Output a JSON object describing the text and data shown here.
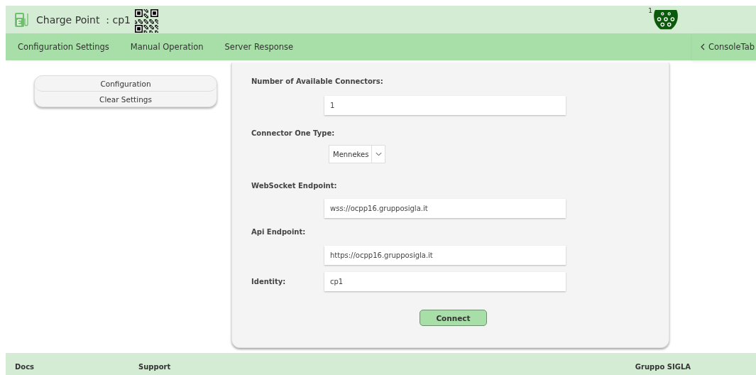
{
  "header": {
    "title": "Charge Point  : cp1",
    "connector_badge": "1"
  },
  "nav": {
    "tabs": [
      {
        "label": "Configuration Settings"
      },
      {
        "label": "Manual Operation"
      },
      {
        "label": "Server Response"
      }
    ],
    "console_tab": "ConsoleTab"
  },
  "sidebar": {
    "items": [
      {
        "label": "Configuration"
      },
      {
        "label": "Clear Settings"
      }
    ]
  },
  "form": {
    "fields": [
      {
        "kind": "input",
        "label": "Number of Available Connectors:",
        "value": "1"
      },
      {
        "kind": "select",
        "label": "Connector One Type:",
        "value": "Mennekes"
      },
      {
        "kind": "input",
        "label": "WebSocket Endpoint:",
        "value": "wss://ocpp16.grupposigla.it"
      },
      {
        "kind": "input",
        "label": "Api Endpoint:",
        "value": "https://ocpp16.grupposigla.it"
      },
      {
        "kind": "inline",
        "label": "Identity:",
        "value": "cp1"
      }
    ],
    "submit": "Connect"
  },
  "footer": {
    "links": [
      "Docs",
      "Support"
    ],
    "brand": "Gruppo SIGLA"
  }
}
